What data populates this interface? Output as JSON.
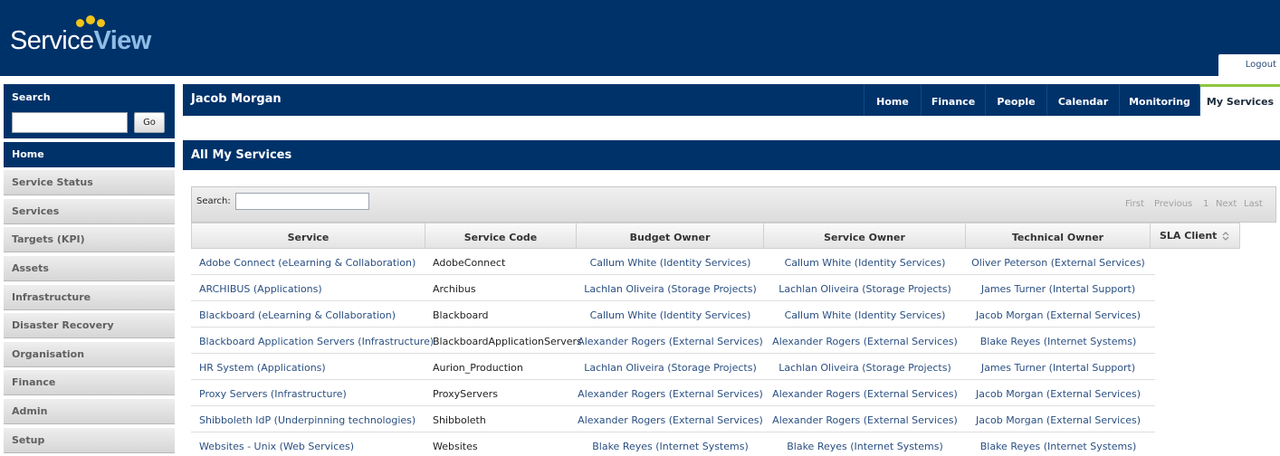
{
  "brand": {
    "name_part1": "Service",
    "name_part2": "View"
  },
  "logout": "Logout",
  "sidebar": {
    "search_title": "Search",
    "go_label": "Go",
    "items": [
      {
        "label": "Home",
        "active": true
      },
      {
        "label": "Service Status"
      },
      {
        "label": "Services"
      },
      {
        "label": "Targets (KPI)"
      },
      {
        "label": "Assets"
      },
      {
        "label": "Infrastructure"
      },
      {
        "label": "Disaster Recovery"
      },
      {
        "label": "Organisation"
      },
      {
        "label": "Finance"
      },
      {
        "label": "Admin"
      },
      {
        "label": "Setup"
      }
    ]
  },
  "user": {
    "name": "Jacob Morgan"
  },
  "top_nav": [
    {
      "label": "Home"
    },
    {
      "label": "Finance"
    },
    {
      "label": "People"
    },
    {
      "label": "Calendar"
    },
    {
      "label": "Monitoring"
    },
    {
      "label": "My Services",
      "active": true
    }
  ],
  "section": {
    "title": "All My Services"
  },
  "table_toolbar": {
    "search_label": "Search:",
    "pager": {
      "first": "First",
      "previous": "Previous",
      "page": "1",
      "next": "Next",
      "last": "Last"
    }
  },
  "table": {
    "headers": [
      "Service",
      "Service Code",
      "Budget Owner",
      "Service Owner",
      "Technical Owner",
      "SLA Client"
    ],
    "rows": [
      [
        "Adobe Connect (eLearning & Collaboration)",
        "AdobeConnect",
        "Callum White (Identity Services)",
        "Callum White (Identity Services)",
        "Oliver Peterson (External Services)"
      ],
      [
        "ARCHIBUS (Applications)",
        "Archibus",
        "Lachlan Oliveira (Storage Projects)",
        "Lachlan Oliveira (Storage Projects)",
        "James Turner (Intertal Support)"
      ],
      [
        "Blackboard (eLearning & Collaboration)",
        "Blackboard",
        "Callum White (Identity Services)",
        "Callum White (Identity Services)",
        "Jacob Morgan (External Services)"
      ],
      [
        "Blackboard Application Servers (Infrastructure)",
        "BlackboardApplicationServers",
        "Alexander Rogers (External Services)",
        "Alexander Rogers (External Services)",
        "Blake Reyes (Internet Systems)"
      ],
      [
        "HR System (Applications)",
        "Aurion_Production",
        "Lachlan Oliveira (Storage Projects)",
        "Lachlan Oliveira (Storage Projects)",
        "James Turner (Intertal Support)"
      ],
      [
        "Proxy Servers (Infrastructure)",
        "ProxyServers",
        "Alexander Rogers (External Services)",
        "Alexander Rogers (External Services)",
        "Jacob Morgan (External Services)"
      ],
      [
        "Shibboleth IdP (Underpinning technologies)",
        "Shibboleth",
        "Alexander Rogers (External Services)",
        "Alexander Rogers (External Services)",
        "Jacob Morgan (External Services)"
      ],
      [
        "Websites - Unix (Web Services)",
        "Websites",
        "Blake Reyes (Internet Systems)",
        "Blake Reyes (Internet Systems)",
        "Blake Reyes (Internet Systems)"
      ]
    ]
  },
  "colors": {
    "primary": "#00326a",
    "accent": "#8dc63f",
    "logo_dots": "#f0c419",
    "link": "#2a4f82"
  }
}
